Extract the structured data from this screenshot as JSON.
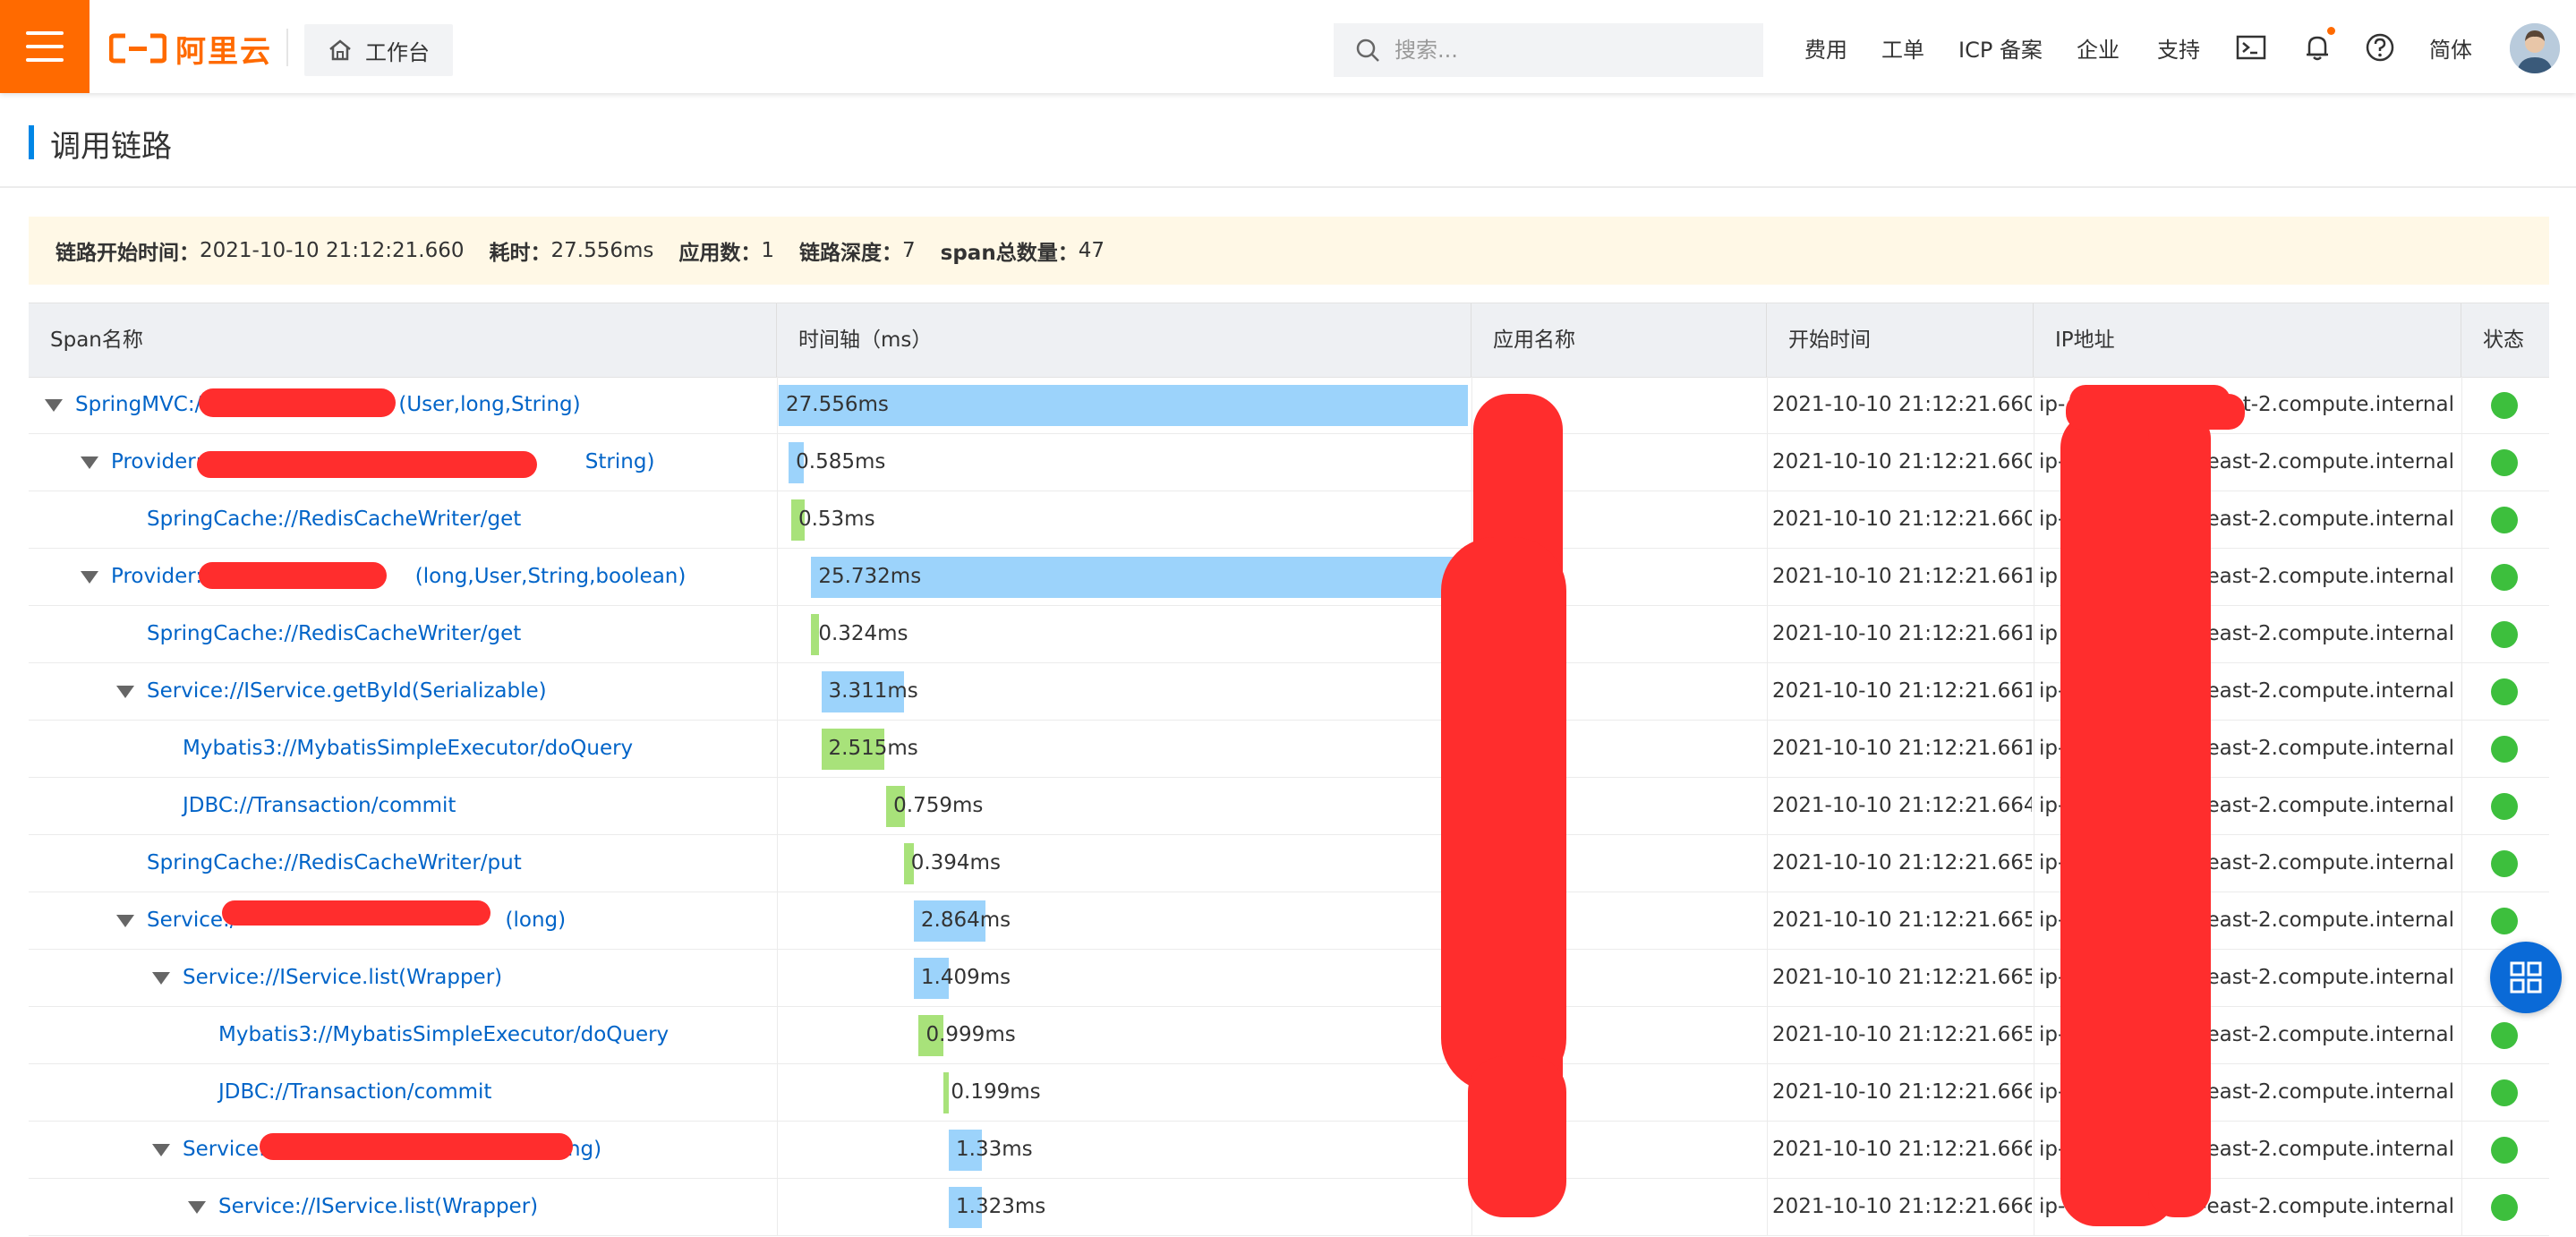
{
  "topbar": {
    "logo_text": "阿里云",
    "workbench_label": "工作台",
    "search_placeholder": "搜索...",
    "nav": [
      "费用",
      "工单",
      "ICP 备案",
      "企业",
      "支持"
    ],
    "lang_label": "简体"
  },
  "page": {
    "title": "调用链路"
  },
  "summary": {
    "start_time_key": "链路开始时间：",
    "start_time": "2021-10-10 21:12:21.660",
    "duration_key": "耗时：",
    "duration": "27.556ms",
    "app_count_key": "应用数：",
    "app_count": "1",
    "depth_key": "链路深度：",
    "depth": "7",
    "span_total_key": "span总数量：",
    "span_total": "47"
  },
  "table": {
    "headers": [
      "Span名称",
      "时间轴（ms）",
      "应用名称",
      "开始时间",
      "IP地址",
      "状态"
    ],
    "total_ms": 27.556,
    "rows": [
      {
        "name_prefix": "SpringMVC:/",
        "name_suffix": "(User,long,String)",
        "depth": 0,
        "expandable": true,
        "duration_label": "27.556ms",
        "offset_ms": 0,
        "duration_ms": 27.556,
        "bar_color": "blue",
        "start": "2021-10-10 21:12:21.660",
        "ip_prefix": "ip-",
        "ip_suffix": "east-2.compute.internal"
      },
      {
        "name_prefix": "Provider:/",
        "name_suffix": "String)",
        "depth": 1,
        "expandable": true,
        "duration_label": "0.585ms",
        "offset_ms": 0.4,
        "duration_ms": 0.585,
        "bar_color": "blue",
        "start": "2021-10-10 21:12:21.660",
        "ip_prefix": "ip-",
        "ip_suffix": "us-east-2.compute.internal"
      },
      {
        "name_prefix": "SpringCache://RedisCacheWriter/get",
        "name_suffix": "",
        "depth": 2,
        "expandable": false,
        "duration_label": "0.53ms",
        "offset_ms": 0.5,
        "duration_ms": 0.53,
        "bar_color": "green",
        "start": "2021-10-10 21:12:21.660",
        "ip_prefix": "ip-",
        "ip_suffix": "us-east-2.compute.internal"
      },
      {
        "name_prefix": "Provider:/",
        "name_suffix": "(long,User,String,boolean)",
        "depth": 1,
        "expandable": true,
        "duration_label": "25.732ms",
        "offset_ms": 1.3,
        "duration_ms": 25.732,
        "bar_color": "blue",
        "start": "2021-10-10 21:12:21.661",
        "ip_prefix": "ip",
        "ip_suffix": "us-east-2.compute.internal"
      },
      {
        "name_prefix": "SpringCache://RedisCacheWriter/get",
        "name_suffix": "",
        "depth": 2,
        "expandable": false,
        "duration_label": "0.324ms",
        "offset_ms": 1.3,
        "duration_ms": 0.324,
        "bar_color": "green",
        "start": "2021-10-10 21:12:21.661",
        "ip_prefix": "ip",
        "ip_suffix": "us-east-2.compute.internal"
      },
      {
        "name_prefix": "Service://IService.getById(Serializable)",
        "name_suffix": "",
        "depth": 2,
        "expandable": true,
        "duration_label": "3.311ms",
        "offset_ms": 1.7,
        "duration_ms": 3.311,
        "bar_color": "blue",
        "start": "2021-10-10 21:12:21.661",
        "ip_prefix": "ip-",
        "ip_suffix": "us-east-2.compute.internal"
      },
      {
        "name_prefix": "Mybatis3://MybatisSimpleExecutor/doQuery",
        "name_suffix": "",
        "depth": 3,
        "expandable": false,
        "duration_label": "2.515ms",
        "offset_ms": 1.7,
        "duration_ms": 2.515,
        "bar_color": "green",
        "start": "2021-10-10 21:12:21.661",
        "ip_prefix": "ip-",
        "ip_suffix": "7.us-east-2.compute.internal"
      },
      {
        "name_prefix": "JDBC://Transaction/commit",
        "name_suffix": "",
        "depth": 3,
        "expandable": false,
        "duration_label": "0.759ms",
        "offset_ms": 4.3,
        "duration_ms": 0.759,
        "bar_color": "green",
        "start": "2021-10-10 21:12:21.664",
        "ip_prefix": "ip-",
        "ip_suffix": "7.us-east-2.compute.internal"
      },
      {
        "name_prefix": "SpringCache://RedisCacheWriter/put",
        "name_suffix": "",
        "depth": 2,
        "expandable": false,
        "duration_label": "0.394ms",
        "offset_ms": 5.0,
        "duration_ms": 0.394,
        "bar_color": "green",
        "start": "2021-10-10 21:12:21.665",
        "ip_prefix": "ip-",
        "ip_suffix": "7.us-east-2.compute.internal"
      },
      {
        "name_prefix": "Service:/",
        "name_suffix": "(long)",
        "depth": 2,
        "expandable": true,
        "duration_label": "2.864ms",
        "offset_ms": 5.4,
        "duration_ms": 2.864,
        "bar_color": "blue",
        "start": "2021-10-10 21:12:21.665",
        "ip_prefix": "ip-",
        "ip_suffix": "7.us-east-2.compute.internal"
      },
      {
        "name_prefix": "Service://IService.list(Wrapper)",
        "name_suffix": "",
        "depth": 3,
        "expandable": true,
        "duration_label": "1.409ms",
        "offset_ms": 5.4,
        "duration_ms": 1.409,
        "bar_color": "blue",
        "start": "2021-10-10 21:12:21.665",
        "ip_prefix": "ip-",
        "ip_suffix": "us-east-2.compute.internal"
      },
      {
        "name_prefix": "Mybatis3://MybatisSimpleExecutor/doQuery",
        "name_suffix": "",
        "depth": 4,
        "expandable": false,
        "duration_label": "0.999ms",
        "offset_ms": 5.6,
        "duration_ms": 0.999,
        "bar_color": "green",
        "start": "2021-10-10 21:12:21.665",
        "ip_prefix": "ip-",
        "ip_suffix": "us-east-2.compute.internal"
      },
      {
        "name_prefix": "JDBC://Transaction/commit",
        "name_suffix": "",
        "depth": 4,
        "expandable": false,
        "duration_label": "0.199ms",
        "offset_ms": 6.6,
        "duration_ms": 0.199,
        "bar_color": "green",
        "start": "2021-10-10 21:12:21.666",
        "ip_prefix": "ip-",
        "ip_suffix": "us-east-2.compute.internal"
      },
      {
        "name_prefix": "Service:/",
        "name_suffix": "(long)",
        "depth": 3,
        "expandable": true,
        "duration_label": "1.33ms",
        "offset_ms": 6.8,
        "duration_ms": 1.33,
        "bar_color": "blue",
        "start": "2021-10-10 21:12:21.666",
        "ip_prefix": "ip-",
        "ip_suffix": "us-east-2.compute.internal"
      },
      {
        "name_prefix": "Service://IService.list(Wrapper)",
        "name_suffix": "",
        "depth": 4,
        "expandable": true,
        "duration_label": "1.323ms",
        "offset_ms": 6.8,
        "duration_ms": 1.323,
        "bar_color": "blue",
        "start": "2021-10-10 21:12:21.666",
        "ip_prefix": "ip-",
        "ip_suffix": "us-east-2.compute.internal"
      }
    ]
  },
  "colors": {
    "brand": "#ff6a00",
    "link": "#0064c8",
    "bar_blue": "#9cd3fb",
    "bar_green": "#a8e27a",
    "status_ok": "#3dbf3d",
    "redaction": "#ff2d2d",
    "fab": "#0a6ad7"
  },
  "icons": {
    "menu": "hamburger-icon",
    "home": "home-icon",
    "search": "search-icon",
    "terminal": "terminal-icon",
    "bell": "bell-icon",
    "help": "help-icon",
    "fab": "grid-icon"
  }
}
